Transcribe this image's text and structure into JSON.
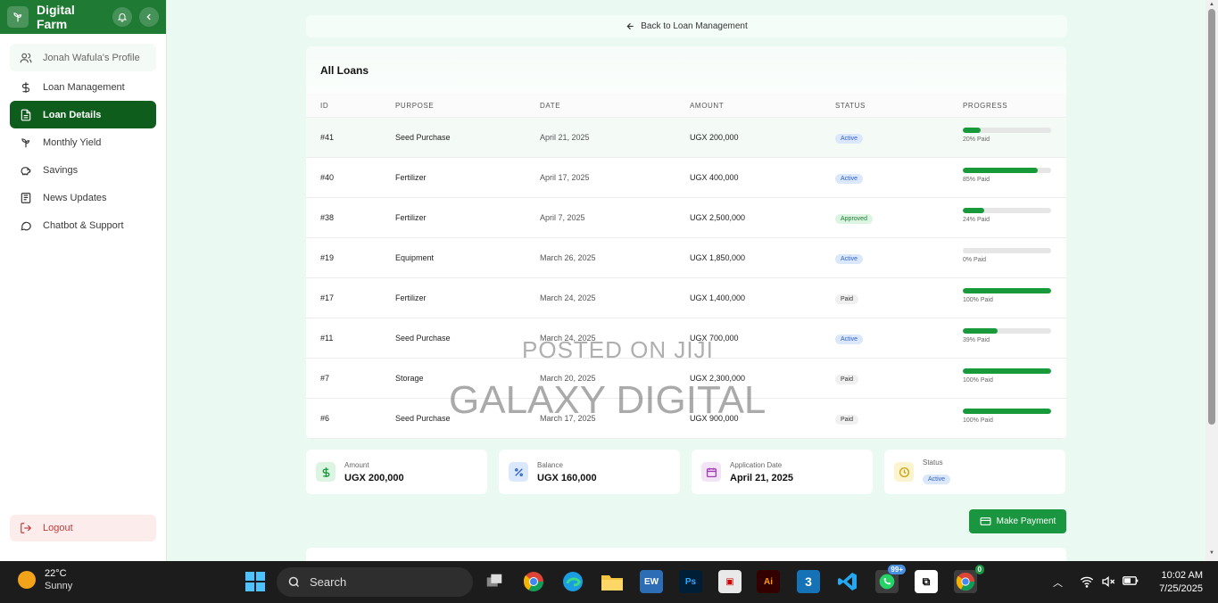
{
  "app": {
    "title": "Digital Farm"
  },
  "sidebar": {
    "items": [
      {
        "label": "Jonah Wafula's Profile",
        "icon": "users-icon"
      },
      {
        "label": "Loan Management",
        "icon": "dollar-icon"
      },
      {
        "label": "Loan Details",
        "icon": "document-icon",
        "active": true
      },
      {
        "label": "Monthly Yield",
        "icon": "sprout-icon"
      },
      {
        "label": "Savings",
        "icon": "piggy-bank-icon"
      },
      {
        "label": "News Updates",
        "icon": "newspaper-icon"
      },
      {
        "label": "Chatbot & Support",
        "icon": "chat-icon"
      }
    ],
    "logout": "Logout"
  },
  "back_link": "Back to Loan Management",
  "table": {
    "title": "All Loans",
    "columns": [
      "ID",
      "PURPOSE",
      "DATE",
      "AMOUNT",
      "STATUS",
      "PROGRESS"
    ],
    "rows": [
      {
        "id": "#41",
        "purpose": "Seed Purchase",
        "date": "April 21, 2025",
        "amount": "UGX 200,000",
        "status": "Active",
        "progress": 20,
        "progress_label": "20% Paid"
      },
      {
        "id": "#40",
        "purpose": "Fertilizer",
        "date": "April 17, 2025",
        "amount": "UGX 400,000",
        "status": "Active",
        "progress": 85,
        "progress_label": "85% Paid"
      },
      {
        "id": "#38",
        "purpose": "Fertilizer",
        "date": "April 7, 2025",
        "amount": "UGX 2,500,000",
        "status": "Approved",
        "progress": 24,
        "progress_label": "24% Paid"
      },
      {
        "id": "#19",
        "purpose": "Equipment",
        "date": "March 26, 2025",
        "amount": "UGX 1,850,000",
        "status": "Active",
        "progress": 0,
        "progress_label": "0% Paid"
      },
      {
        "id": "#17",
        "purpose": "Fertilizer",
        "date": "March 24, 2025",
        "amount": "UGX 1,400,000",
        "status": "Paid",
        "progress": 100,
        "progress_label": "100% Paid"
      },
      {
        "id": "#11",
        "purpose": "Seed Purchase",
        "date": "March 24, 2025",
        "amount": "UGX 700,000",
        "status": "Active",
        "progress": 39,
        "progress_label": "39% Paid"
      },
      {
        "id": "#7",
        "purpose": "Storage",
        "date": "March 20, 2025",
        "amount": "UGX 2,300,000",
        "status": "Paid",
        "progress": 100,
        "progress_label": "100% Paid"
      },
      {
        "id": "#6",
        "purpose": "Seed Purchase",
        "date": "March 17, 2025",
        "amount": "UGX 900,000",
        "status": "Paid",
        "progress": 100,
        "progress_label": "100% Paid"
      }
    ]
  },
  "summary": {
    "amount_label": "Amount",
    "amount_value": "UGX 200,000",
    "balance_label": "Balance",
    "balance_value": "UGX 160,000",
    "date_label": "Application Date",
    "date_value": "April 21, 2025",
    "status_label": "Status",
    "status_value": "Active"
  },
  "make_payment": "Make Payment",
  "watermark": {
    "line1": "POSTED ON JIJI",
    "line2": "GALAXY DIGITAL"
  },
  "taskbar": {
    "temperature": "22°C",
    "condition": "Sunny",
    "search": "Search",
    "whatsapp_badge": "99+",
    "chrome_badge": "0",
    "time": "10:02 AM",
    "date": "7/25/2025"
  },
  "colors": {
    "brand": "#1f7a34",
    "active_nav": "#0f5d1c",
    "progress": "#18993a",
    "button": "#1a9641"
  }
}
